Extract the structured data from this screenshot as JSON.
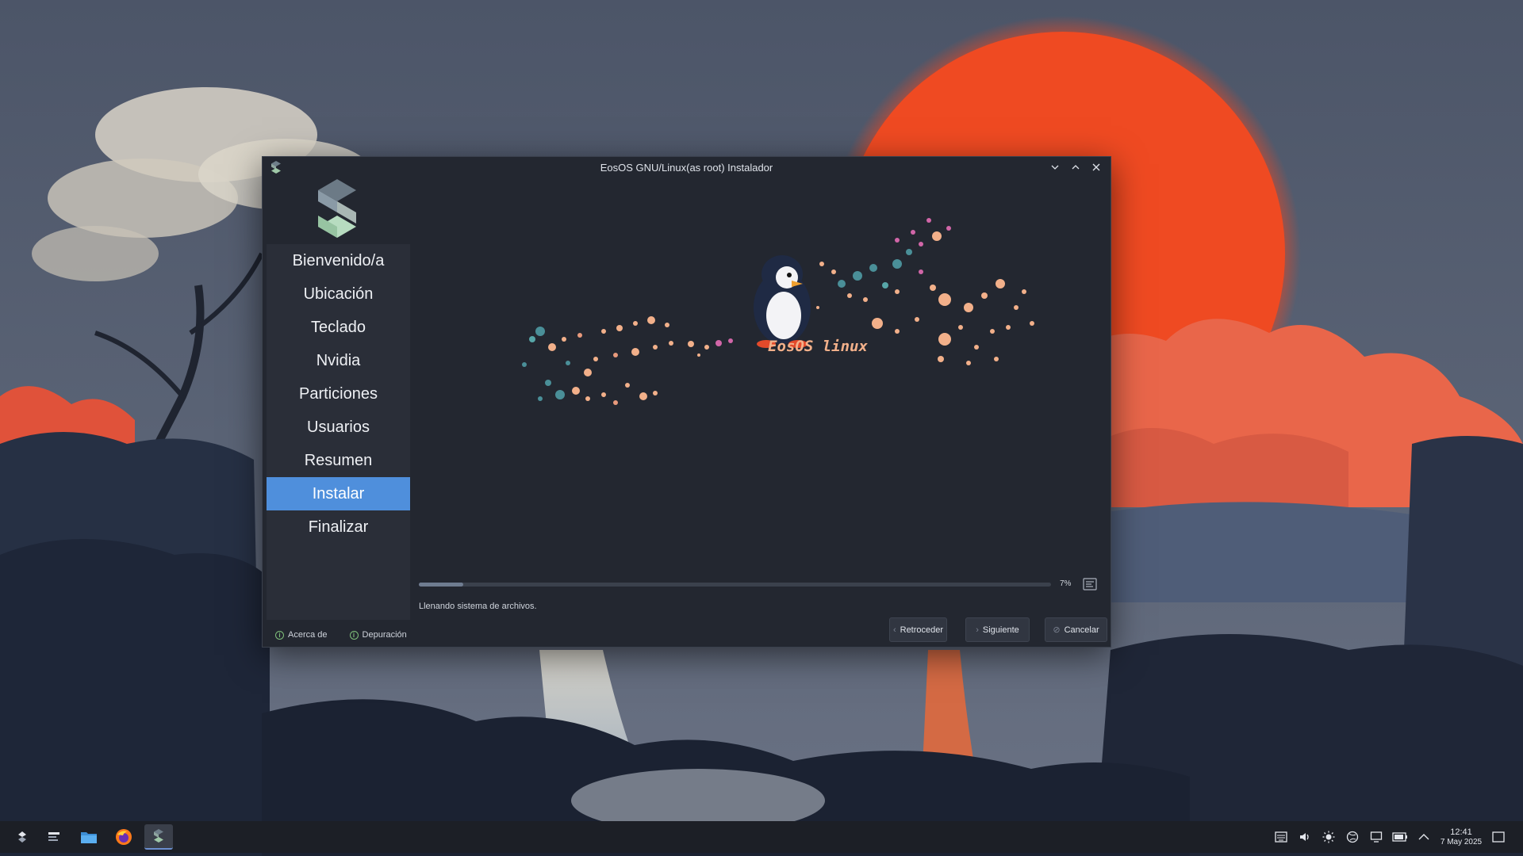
{
  "window": {
    "title": "EosOS GNU/Linux(as root) Instalador",
    "controls": [
      "minimize",
      "maximize",
      "close"
    ]
  },
  "sidebar": {
    "items": [
      {
        "label": "Bienvenido/a",
        "active": false
      },
      {
        "label": "Ubicación",
        "active": false
      },
      {
        "label": "Teclado",
        "active": false
      },
      {
        "label": "Nvidia",
        "active": false
      },
      {
        "label": "Particiones",
        "active": false
      },
      {
        "label": "Usuarios",
        "active": false
      },
      {
        "label": "Resumen",
        "active": false
      },
      {
        "label": "Instalar",
        "active": true
      },
      {
        "label": "Finalizar",
        "active": false
      }
    ],
    "about_label": "Acerca de",
    "debug_label": "Depuración"
  },
  "slide": {
    "brand_text": "EosOS linux"
  },
  "install": {
    "progress_percent": 7,
    "progress_label": "7%",
    "status": "Llenando sistema de archivos."
  },
  "buttons": {
    "back": "Retroceder",
    "next": "Siguiente",
    "cancel": "Cancelar"
  },
  "taskbar": {
    "apps": [
      "application-launcher-icon",
      "show-desktop-icon",
      "file-manager-icon",
      "firefox-icon",
      "installer-icon"
    ],
    "time": "12:41",
    "date": "7 May 2025"
  },
  "colors": {
    "accent": "#4f8fdc",
    "window_bg": "#232730",
    "sidebar_bg": "#2a2e38",
    "brand_text": "#f2b08a"
  }
}
